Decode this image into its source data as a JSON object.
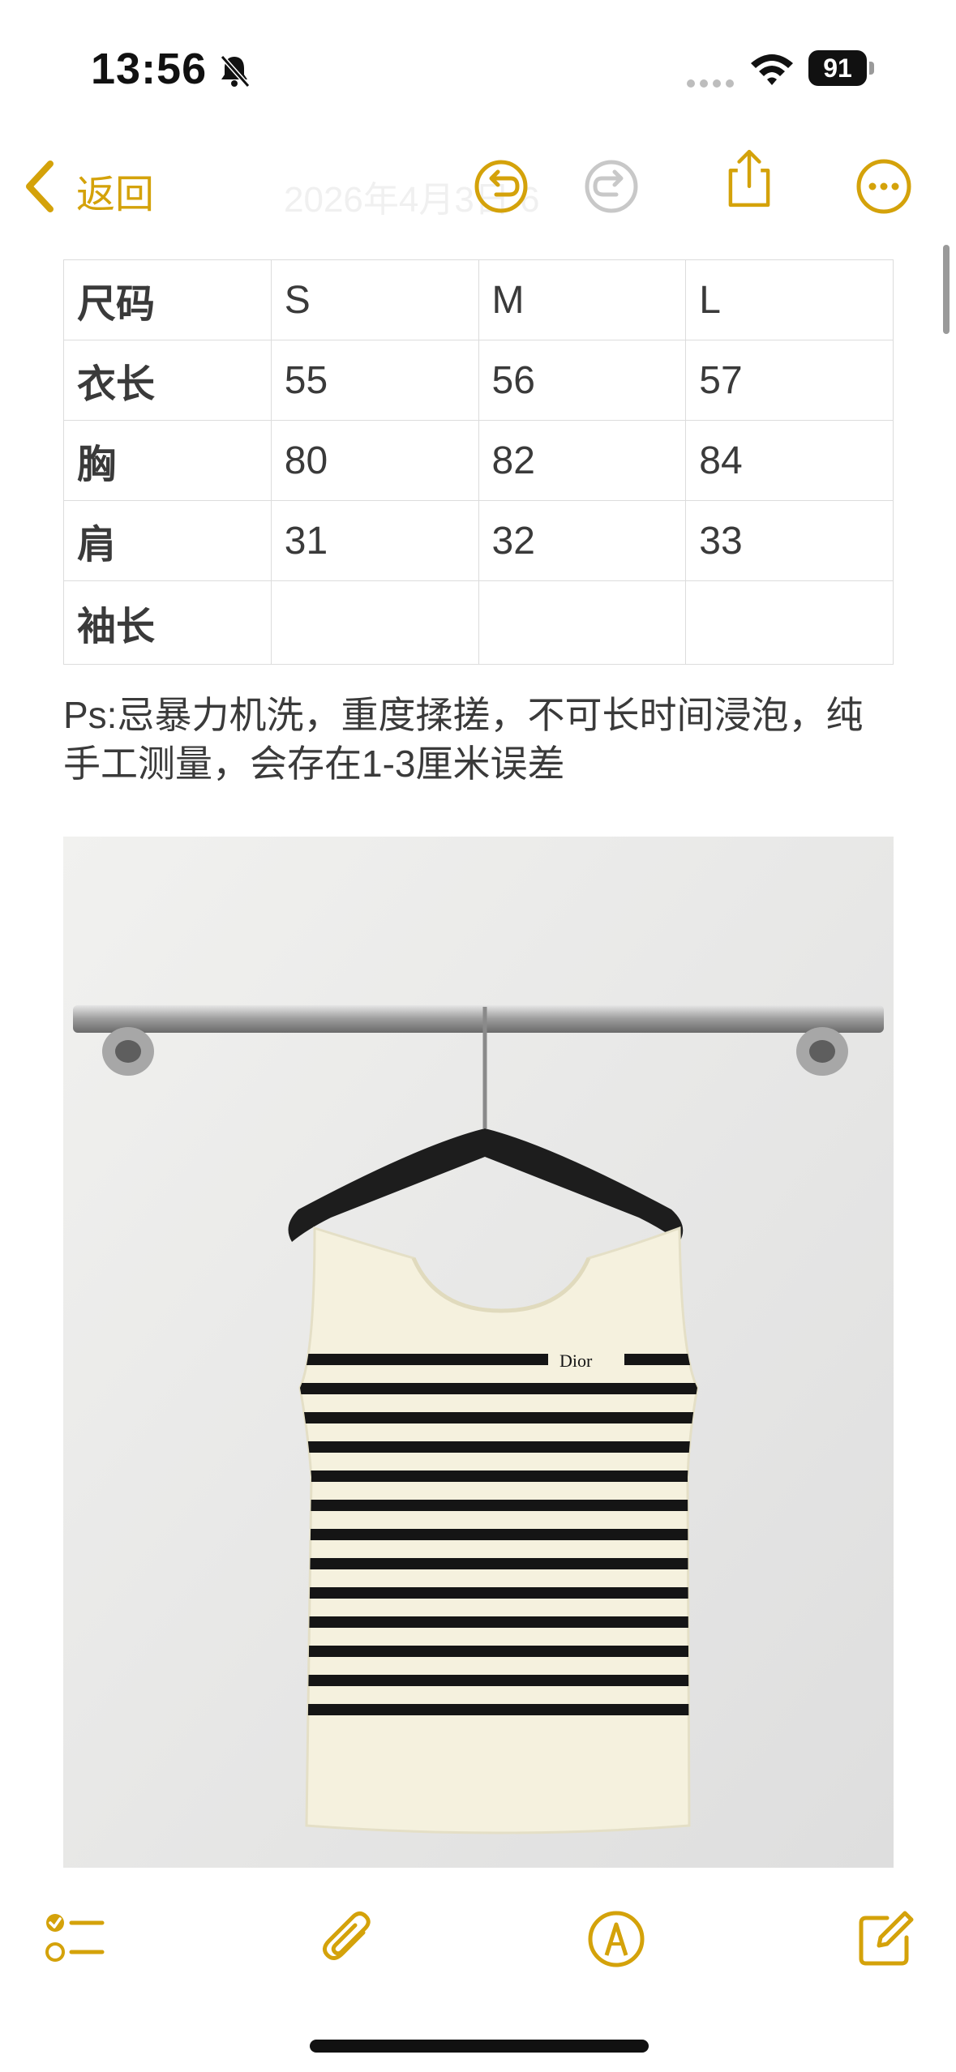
{
  "status_bar": {
    "time": "13:56",
    "battery_level": "91",
    "icons": [
      "bell-slash-icon",
      "cellular-dots-icon",
      "wifi-icon",
      "battery-icon"
    ]
  },
  "nav": {
    "back_label": "返回",
    "title": "2026年4月3日 6",
    "icons": [
      "chevron-left-icon",
      "undo-icon",
      "redo-icon",
      "share-icon",
      "more-icon"
    ]
  },
  "size_table": {
    "rows": [
      [
        "尺码",
        "S",
        "M",
        "L"
      ],
      [
        "衣长",
        "55",
        "56",
        "57"
      ],
      [
        "胸",
        "80",
        "82",
        "84"
      ],
      [
        "肩",
        "31",
        "32",
        "33"
      ],
      [
        "袖长",
        "",
        "",
        ""
      ]
    ]
  },
  "note": {
    "text": "Ps:忌暴力机洗，重度揉搓，不可长时间浸泡，纯手工测量，会存在1-3厘米误差"
  },
  "photo": {
    "logo_text": "Dior",
    "description_icon": "striped-tank-top-photo"
  },
  "toolbar": {
    "icons": [
      "checklist-icon",
      "paperclip-icon",
      "markup-pen-icon",
      "compose-icon"
    ]
  },
  "colors": {
    "accent": "#D4A20A",
    "text": "#3A3A3A",
    "table_border": "#DCDCDC",
    "wall": "#E9E9E7",
    "garment": "#F5F1DE",
    "stripe": "#151515"
  }
}
